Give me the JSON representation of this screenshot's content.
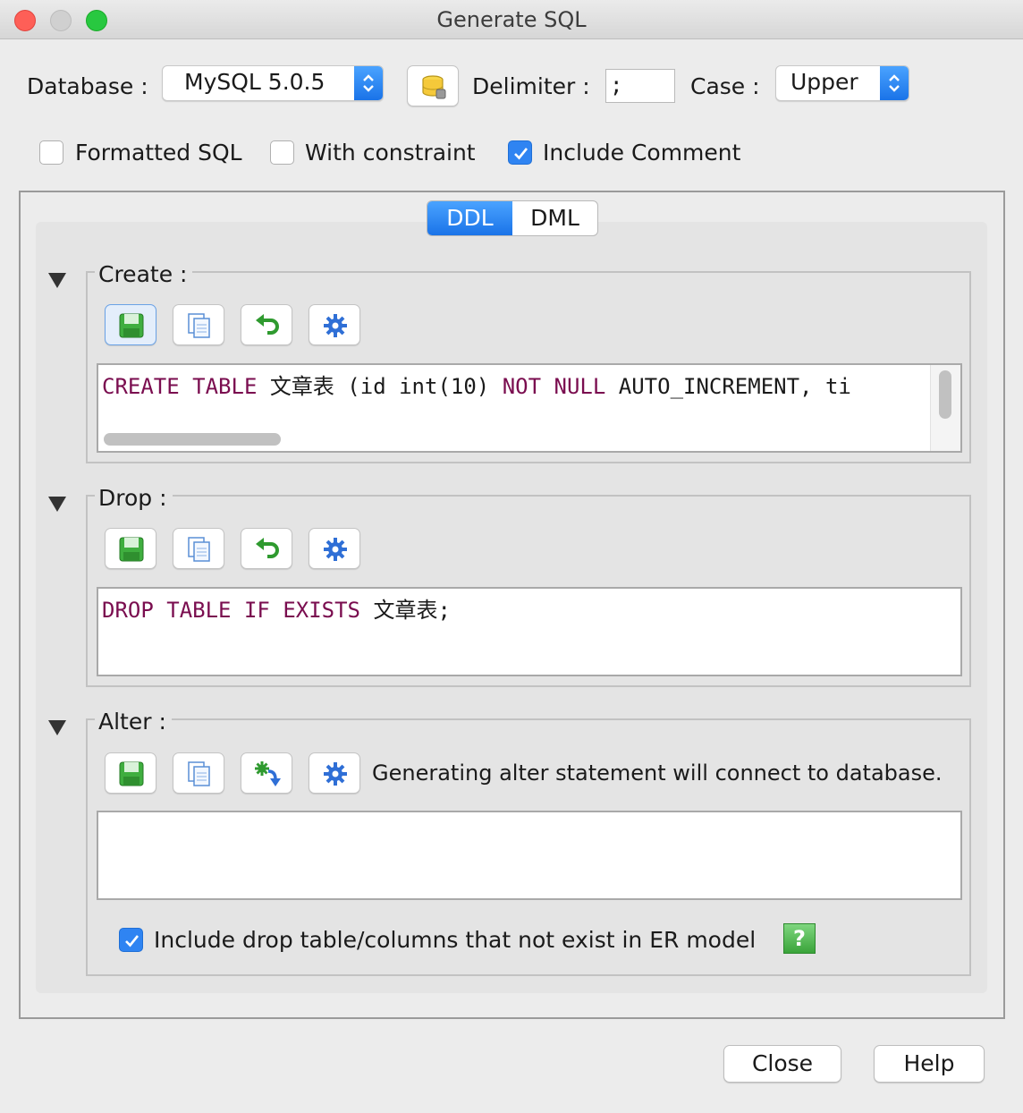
{
  "window": {
    "title": "Generate SQL"
  },
  "toolbar": {
    "database_label": "Database :",
    "database_value": "MySQL 5.0.5",
    "delimiter_label": "Delimiter :",
    "delimiter_value": ";",
    "case_label": "Case :",
    "case_value": "Upper"
  },
  "options": [
    {
      "label": "Formatted SQL",
      "checked": false
    },
    {
      "label": "With constraint",
      "checked": false
    },
    {
      "label": "Include Comment",
      "checked": true
    }
  ],
  "tabs": [
    {
      "label": "DDL",
      "active": true
    },
    {
      "label": "DML",
      "active": false
    }
  ],
  "sections": {
    "create": {
      "label": "Create :",
      "tokens": [
        "CREATE",
        "TABLE",
        "文章表 (id int(10)",
        "NOT",
        "NULL",
        "AUTO_INCREMENT, ti"
      ]
    },
    "drop": {
      "label": "Drop :",
      "tokens": [
        "DROP",
        "TABLE",
        "IF",
        "EXISTS",
        "文章表;"
      ]
    },
    "alter": {
      "label": "Alter :",
      "note": "Generating alter statement will connect to database.",
      "sql": "",
      "include_drop_label": "Include drop table/columns that not exist in ER model",
      "include_drop_checked": true,
      "help_glyph": "?"
    }
  },
  "buttons": {
    "close": "Close",
    "help": "Help"
  },
  "colors": {
    "accent": "#1a73e8",
    "keyword": "#7a0d4f"
  }
}
